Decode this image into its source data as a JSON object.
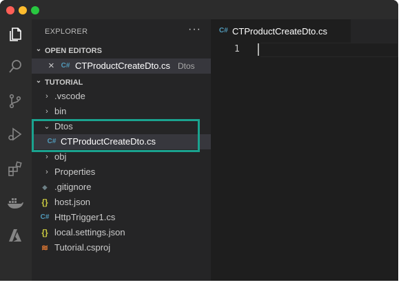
{
  "window": {
    "traffic_lights": [
      "close-dot",
      "minimize-dot",
      "zoom-dot"
    ]
  },
  "colors": {
    "accent": "#1aa38f",
    "csharp": "#519aba",
    "json": "#cbcb41",
    "rss": "#e37933"
  },
  "activity_bar": {
    "icons": [
      "explorer-icon",
      "search-icon",
      "source-control-icon",
      "run-debug-icon",
      "extensions-icon",
      "docker-icon",
      "azure-icon"
    ]
  },
  "sidebar": {
    "header": "EXPLORER",
    "more": "···",
    "open_editors": {
      "title": "OPEN EDITORS",
      "items": [
        {
          "close": "×",
          "icon": "C#",
          "name": "CTProductCreateDto.cs",
          "folder": "Dtos"
        }
      ]
    },
    "tutorial": {
      "title": "TUTORIAL",
      "items": [
        {
          "name": ".vscode",
          "type": "folder",
          "chevron": "›"
        },
        {
          "name": "bin",
          "type": "folder",
          "chevron": "›"
        },
        {
          "name": "Dtos",
          "type": "folder",
          "chevron": "⌄"
        },
        {
          "name": "CTProductCreateDto.cs",
          "type": "file",
          "icon": "C#"
        },
        {
          "name": "obj",
          "type": "folder",
          "chevron": "›"
        },
        {
          "name": "Properties",
          "type": "folder",
          "chevron": "›"
        },
        {
          "name": ".gitignore",
          "type": "file",
          "icon": "◆"
        },
        {
          "name": "host.json",
          "type": "file",
          "icon": "{}"
        },
        {
          "name": "HttpTrigger1.cs",
          "type": "file",
          "icon": "C#"
        },
        {
          "name": "local.settings.json",
          "type": "file",
          "icon": "{}"
        },
        {
          "name": "Tutorial.csproj",
          "type": "file",
          "icon": "≋"
        }
      ]
    }
  },
  "editor": {
    "tab": {
      "icon": "C#",
      "name": "CTProductCreateDto.cs"
    },
    "line_number": "1"
  }
}
